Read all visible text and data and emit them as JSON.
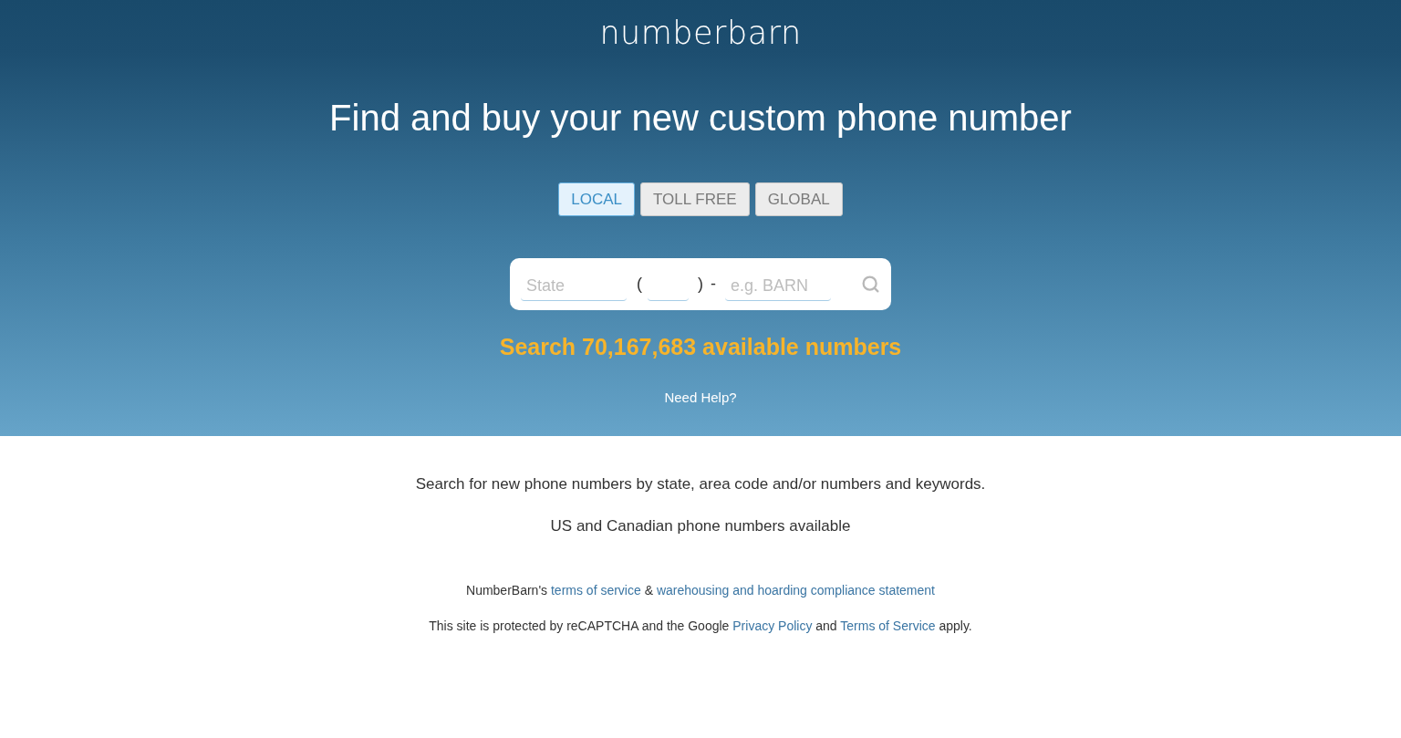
{
  "header": {
    "logo": "numberbarn",
    "headline": "Find and buy your new custom phone number"
  },
  "tabs": [
    {
      "label": "LOCAL",
      "selected": true
    },
    {
      "label": "TOLL FREE",
      "selected": false
    },
    {
      "label": "GLOBAL",
      "selected": false
    }
  ],
  "search_box": {
    "state_field": {
      "placeholder": "State"
    },
    "open_paren": "(",
    "close_paren": ")",
    "dash": "-",
    "keyword_field": {
      "placeholder": "e.g. BARN"
    }
  },
  "available_count": "Search 70,167,683 available numbers",
  "help_link": "Need Help?",
  "info": [
    "Search for new phone numbers by state, area code and/or numbers and keywords.",
    "US and Canadian phone numbers available"
  ],
  "legal": [
    [
      {
        "kind": "text",
        "text": "NumberBarn's "
      },
      {
        "kind": "link",
        "text": "terms of service"
      },
      {
        "kind": "text",
        "text": " & "
      },
      {
        "kind": "link",
        "text": "warehousing and hoarding compliance statement"
      }
    ],
    [
      {
        "kind": "text",
        "text": "This site is protected by reCAPTCHA and the Google "
      },
      {
        "kind": "link",
        "text": "Privacy Policy"
      },
      {
        "kind": "text",
        "text": " and "
      },
      {
        "kind": "link",
        "text": "Terms of Service"
      },
      {
        "kind": "text",
        "text": " apply."
      }
    ]
  ]
}
